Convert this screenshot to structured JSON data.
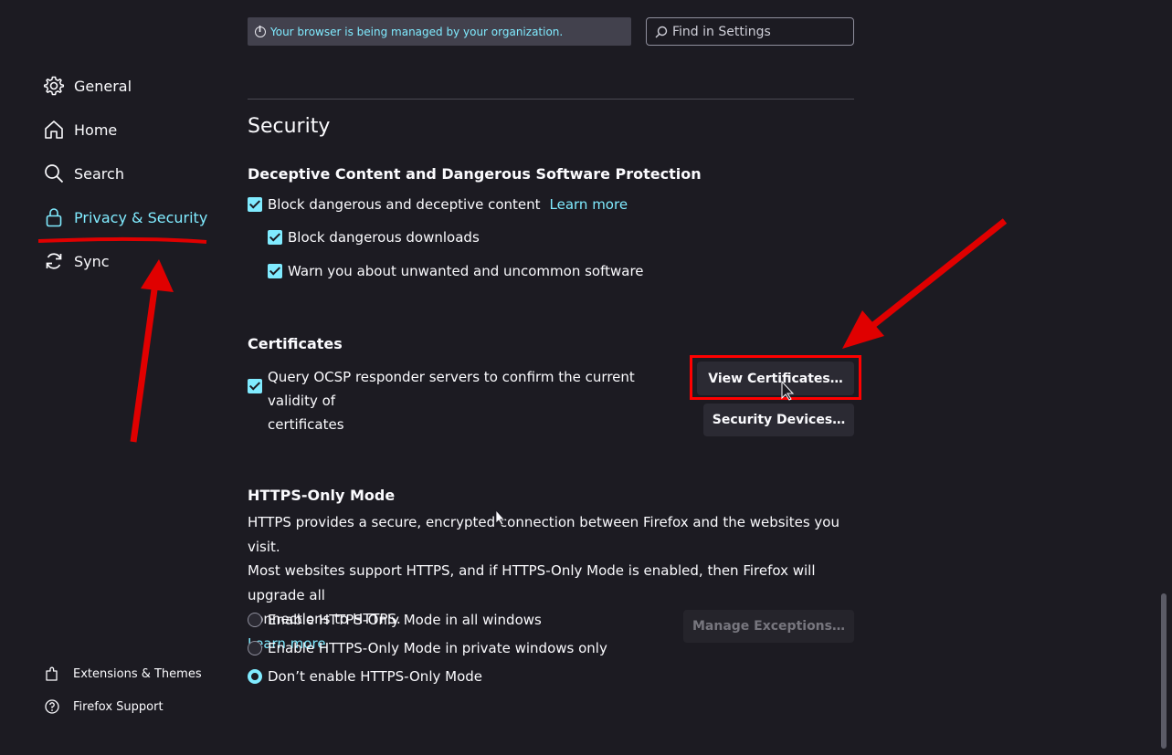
{
  "header": {
    "managed_notice": "Your browser is being managed by your organization.",
    "search_placeholder": "Find in Settings"
  },
  "sidebar": {
    "items": [
      {
        "label": "General",
        "icon": "gear-icon"
      },
      {
        "label": "Home",
        "icon": "home-icon"
      },
      {
        "label": "Search",
        "icon": "search-icon"
      },
      {
        "label": "Privacy & Security",
        "icon": "lock-icon",
        "active": true
      },
      {
        "label": "Sync",
        "icon": "sync-icon"
      }
    ],
    "footer": [
      {
        "label": "Extensions & Themes",
        "icon": "puzzle-icon"
      },
      {
        "label": "Firefox Support",
        "icon": "help-icon"
      }
    ]
  },
  "security": {
    "title": "Security",
    "deceptive": {
      "heading": "Deceptive Content and Dangerous Software Protection",
      "block_label": "Block dangerous and deceptive content",
      "learn_more": "Learn more",
      "downloads_label": "Block dangerous downloads",
      "uncommon_label": "Warn you about unwanted and uncommon software"
    },
    "certificates": {
      "heading": "Certificates",
      "ocsp_label_line1": "Query OCSP responder servers to confirm the current validity of",
      "ocsp_label_line2": "certificates",
      "view_button": "View Certificates…",
      "devices_button": "Security Devices…"
    },
    "https_only": {
      "heading": "HTTPS-Only Mode",
      "description_line1": "HTTPS provides a secure, encrypted connection between Firefox and the websites you visit.",
      "description_line2": "Most websites support HTTPS, and if HTTPS-Only Mode is enabled, then Firefox will upgrade all",
      "description_line3": "connections to HTTPS.",
      "learn_more": "Learn more",
      "options": [
        "Enable HTTPS-Only Mode in all windows",
        "Enable HTTPS-Only Mode in private windows only",
        "Don’t enable HTTPS-Only Mode"
      ],
      "selected_index": 2,
      "manage_button": "Manage Exceptions…"
    }
  },
  "colors": {
    "accent": "#80ebff",
    "background": "#1c1b22",
    "annotation": "#ff0000"
  }
}
